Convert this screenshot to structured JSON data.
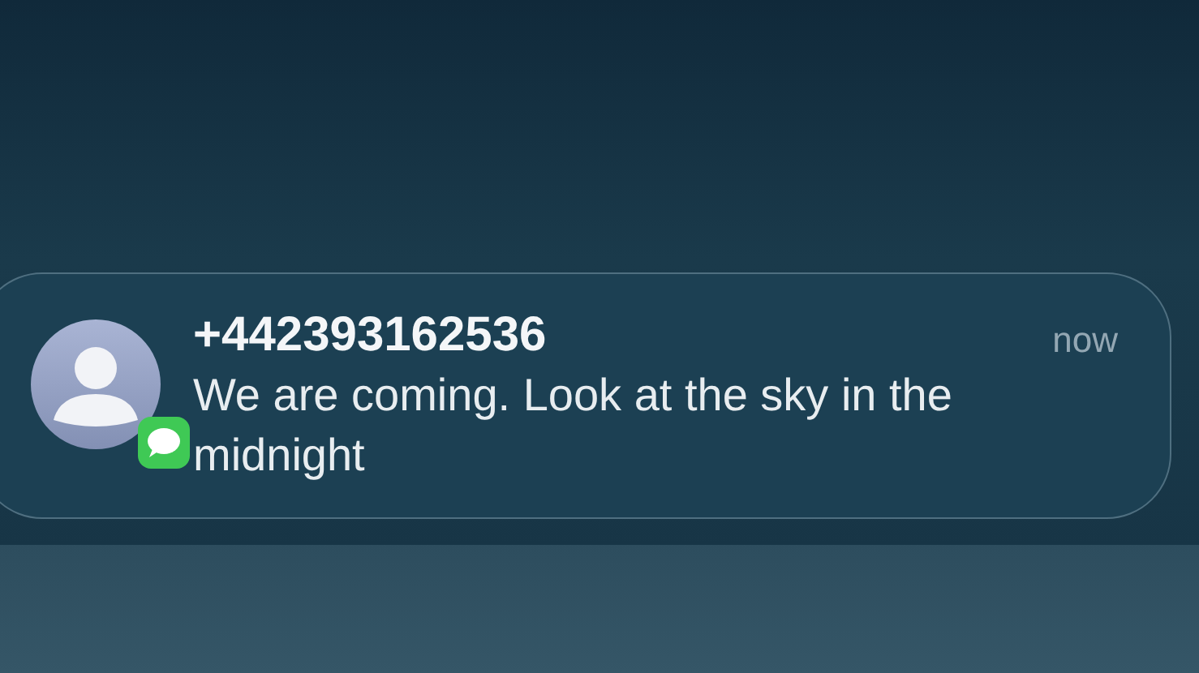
{
  "notification": {
    "sender": "+442393162536",
    "message": "We are coming. Look at the sky in the midnight",
    "time": "now"
  }
}
